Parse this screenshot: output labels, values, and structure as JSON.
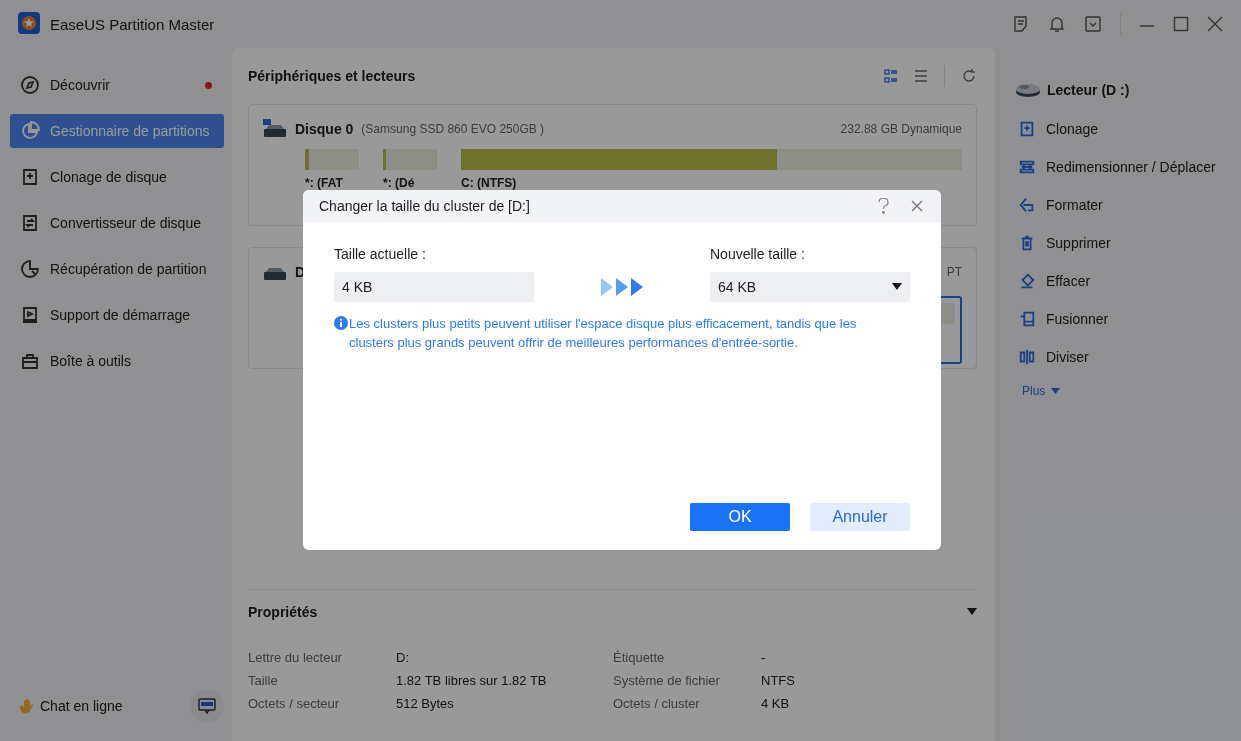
{
  "app": {
    "title": "EaseUS Partition Master"
  },
  "sidebar": {
    "items": [
      {
        "label": "Découvrir",
        "selected": false,
        "badge": true
      },
      {
        "label": "Gestionnaire de partitions",
        "selected": true,
        "badge": false
      },
      {
        "label": "Clonage de disque",
        "selected": false,
        "badge": false
      },
      {
        "label": "Convertisseur de disque",
        "selected": false,
        "badge": false
      },
      {
        "label": "Récupération de partition",
        "selected": false,
        "badge": false
      },
      {
        "label": "Support de démarrage",
        "selected": false,
        "badge": false
      },
      {
        "label": "Boîte à outils",
        "selected": false,
        "badge": false
      }
    ],
    "chat": "Chat en ligne"
  },
  "devices": {
    "title": "Périphériques et lecteurs",
    "disks": [
      {
        "name": "Disque 0",
        "model": "(Samsung SSD 860 EVO 250GB )",
        "info": "232.88 GB Dynamique",
        "partitions": [
          {
            "label": "*: (FAT",
            "level": 0.08,
            "selected": false
          },
          {
            "label": "*: (Dé",
            "level": 0.05,
            "selected": false
          },
          {
            "label": "C: (NTFS)",
            "level": 0.63,
            "selected": false
          }
        ]
      },
      {
        "name": "D",
        "info": "PT",
        "partitions": [
          {
            "selected": true
          }
        ]
      }
    ]
  },
  "properties": {
    "title": "Propriétés",
    "rows": [
      {
        "label": "Lettre du lecteur",
        "value": "D:"
      },
      {
        "label": "Étiquette",
        "value": "-"
      },
      {
        "label": "Taille",
        "value": "1.82 TB libres sur 1.82 TB"
      },
      {
        "label": "Système de fichier",
        "value": "NTFS"
      },
      {
        "label": "Octets / secteur",
        "value": "512 Bytes"
      },
      {
        "label": "Octets / cluster",
        "value": "4 KB"
      }
    ]
  },
  "actions": {
    "title": "Lecteur (D :)",
    "items": [
      {
        "label": "Clonage"
      },
      {
        "label": "Redimensionner / Déplacer"
      },
      {
        "label": "Formater"
      },
      {
        "label": "Supprimer"
      },
      {
        "label": "Effacer"
      },
      {
        "label": "Fusionner"
      },
      {
        "label": "Diviser"
      }
    ],
    "more": "Plus"
  },
  "dialog": {
    "title": "Changer la taille du cluster de [D:]",
    "current_label": "Taille actuelle :",
    "current_value": "4 KB",
    "new_label": "Nouvelle taille :",
    "new_value": "64 KB",
    "info": "Les clusters plus petits peuvent utiliser l'espace disque plus efficacement, tandis que les clusters plus grands peuvent offrir de meilleures performances d'entrée-sortie.",
    "ok": "OK",
    "cancel": "Annuler"
  }
}
